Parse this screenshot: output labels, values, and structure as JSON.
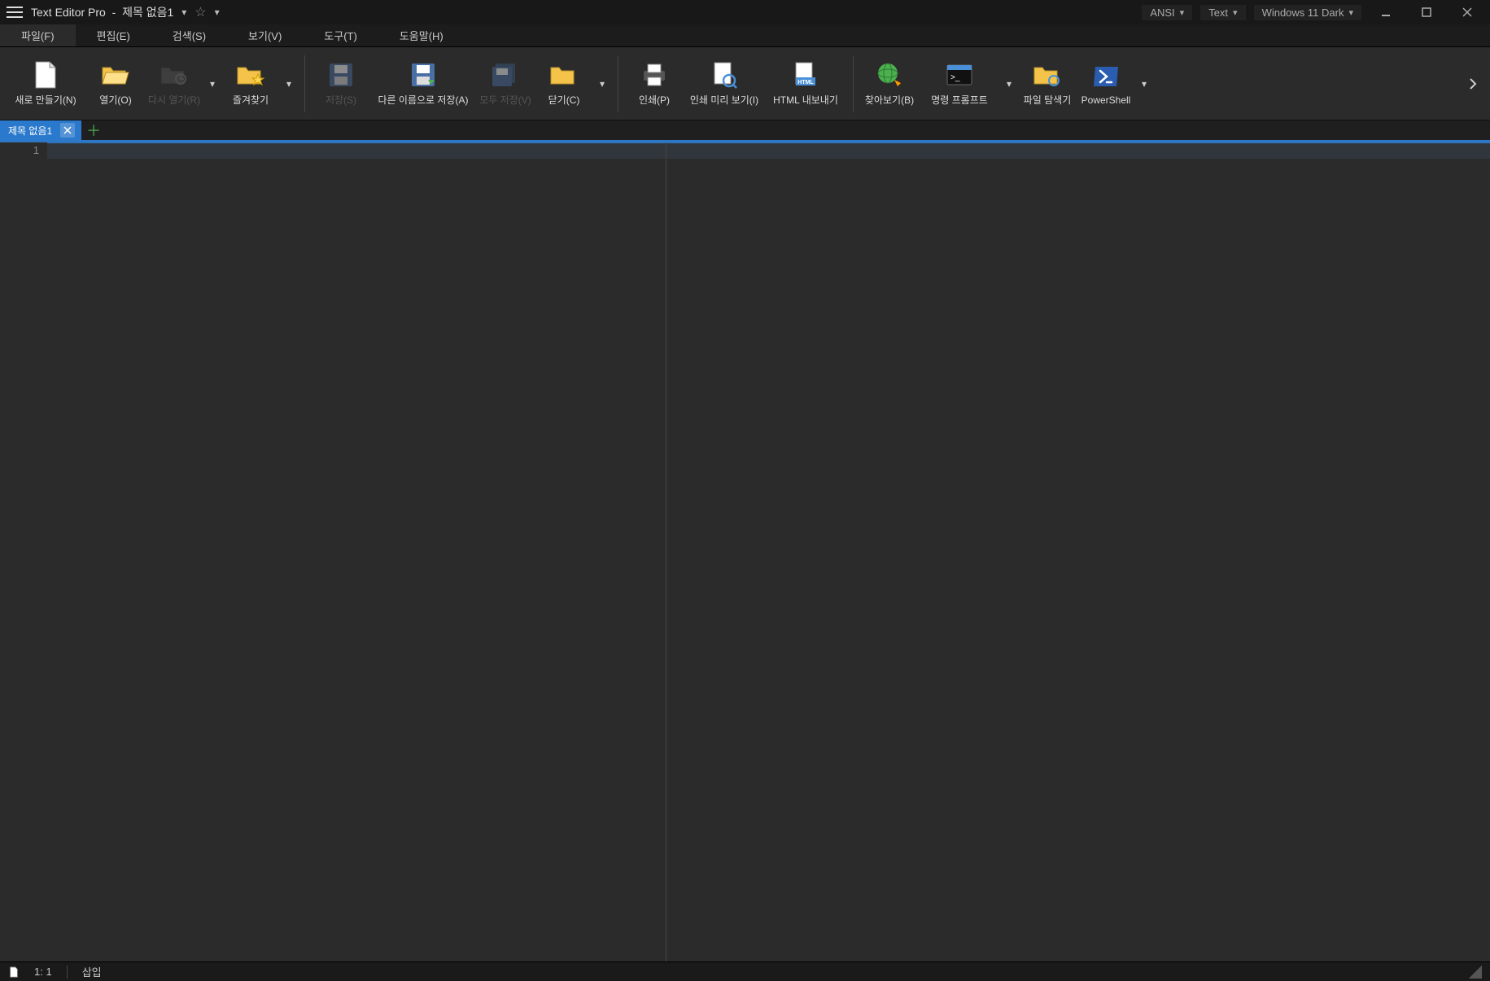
{
  "title": {
    "app": "Text Editor Pro",
    "separator": "-",
    "document": "제목 없음1"
  },
  "titlebar_combos": {
    "encoding": "ANSI",
    "highlighter": "Text",
    "theme": "Windows 11 Dark"
  },
  "menu": {
    "file": "파일(F)",
    "edit": "편집(E)",
    "search": "검색(S)",
    "view": "보기(V)",
    "tools": "도구(T)",
    "help": "도움말(H)"
  },
  "ribbon": {
    "new": "새로 만들기(N)",
    "open": "열기(O)",
    "reopen": "다시 열기(R)",
    "favorites": "즐겨찾기",
    "save": "저장(S)",
    "save_as": "다른 이름으로 저장(A)",
    "save_all": "모두 저장(V)",
    "close": "닫기(C)",
    "print": "인쇄(P)",
    "print_preview": "인쇄 미리 보기(I)",
    "html_export": "HTML 내보내기",
    "browse": "찾아보기(B)",
    "command_prompt": "명령 프롬프트",
    "file_explorer": "파일 탐색기",
    "powershell": "PowerShell"
  },
  "tabs": {
    "doc1": "제목 없음1"
  },
  "editor": {
    "line1": "1"
  },
  "statusbar": {
    "position": "1: 1",
    "insert_mode": "삽입"
  }
}
